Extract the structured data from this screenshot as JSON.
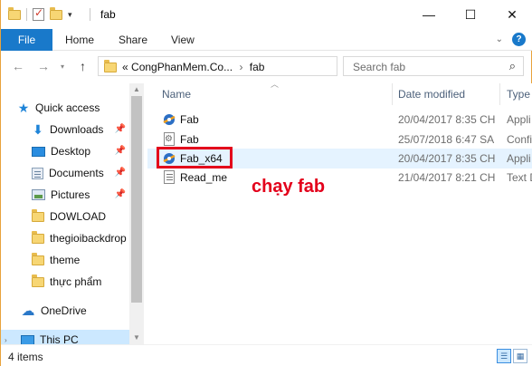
{
  "window": {
    "title": "fab",
    "controls": {
      "minimize": "—",
      "maximize": "☐",
      "close": "✕"
    }
  },
  "ribbon": {
    "tabs": [
      "File",
      "Home",
      "Share",
      "View"
    ],
    "help": "?"
  },
  "address": {
    "prefix": "«",
    "crumbs": [
      "CongPhanMem.Co...",
      "fab"
    ],
    "separator": "›",
    "search_placeholder": "Search fab"
  },
  "nav_pane": {
    "items": [
      {
        "label": "Quick access",
        "icon": "star-icon",
        "pinned": false
      },
      {
        "label": "Downloads",
        "icon": "download-icon",
        "pinned": true
      },
      {
        "label": "Desktop",
        "icon": "desktop-icon",
        "pinned": true
      },
      {
        "label": "Documents",
        "icon": "documents-icon",
        "pinned": true
      },
      {
        "label": "Pictures",
        "icon": "pictures-icon",
        "pinned": true
      },
      {
        "label": "DOWLOAD",
        "icon": "folder-icon",
        "pinned": false
      },
      {
        "label": "thegioibackdrop",
        "icon": "folder-icon",
        "pinned": false
      },
      {
        "label": "theme",
        "icon": "folder-icon",
        "pinned": false
      },
      {
        "label": "thực phẩm",
        "icon": "folder-icon",
        "pinned": false
      },
      {
        "label": "OneDrive",
        "icon": "onedrive-icon",
        "pinned": false
      },
      {
        "label": "This PC",
        "icon": "this-pc-icon",
        "pinned": false
      }
    ]
  },
  "file_list": {
    "columns": {
      "name": "Name",
      "date": "Date modified",
      "type": "Type"
    },
    "rows": [
      {
        "name": "Fab",
        "date": "20/04/2017 8:35 CH",
        "type": "Appli",
        "icon": "fab-app-icon"
      },
      {
        "name": "Fab",
        "date": "25/07/2018 6:47 SA",
        "type": "Confi",
        "icon": "config-file-icon"
      },
      {
        "name": "Fab_x64",
        "date": "20/04/2017 8:35 CH",
        "type": "Appli",
        "icon": "fab-app-icon"
      },
      {
        "name": "Read_me",
        "date": "21/04/2017 8:21 CH",
        "type": "Text D",
        "icon": "text-file-icon"
      }
    ]
  },
  "annotation": {
    "text": "chạy fab",
    "color": "#e3001b"
  },
  "status": {
    "items_count": "4 items"
  },
  "colors": {
    "accent": "#1979ca",
    "selection": "#cce8ff",
    "hover": "#e5f3ff"
  }
}
